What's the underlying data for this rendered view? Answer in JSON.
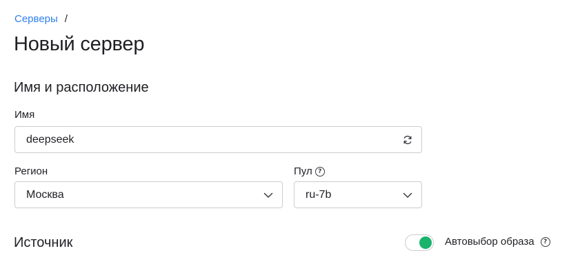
{
  "breadcrumb": {
    "link": "Серверы",
    "separator": "/"
  },
  "page_title": "Новый сервер",
  "sections": {
    "name_location": "Имя и расположение",
    "source": "Источник"
  },
  "fields": {
    "name": {
      "label": "Имя",
      "value": "deepseek",
      "action_icon": "refresh-icon"
    },
    "region": {
      "label": "Регион",
      "value": "Москва",
      "icon": "chevron-down-icon"
    },
    "pool": {
      "label": "Пул",
      "help_icon": "question-circle-icon",
      "value": "ru-7b",
      "icon": "chevron-down-icon"
    }
  },
  "auto_image": {
    "label": "Автовыбор образа",
    "enabled": true,
    "help_icon": "question-circle-icon"
  },
  "colors": {
    "link": "#2f80ed",
    "toggle_on": "#19b36b",
    "border": "#c9ccd1",
    "text": "#1f1f24"
  }
}
